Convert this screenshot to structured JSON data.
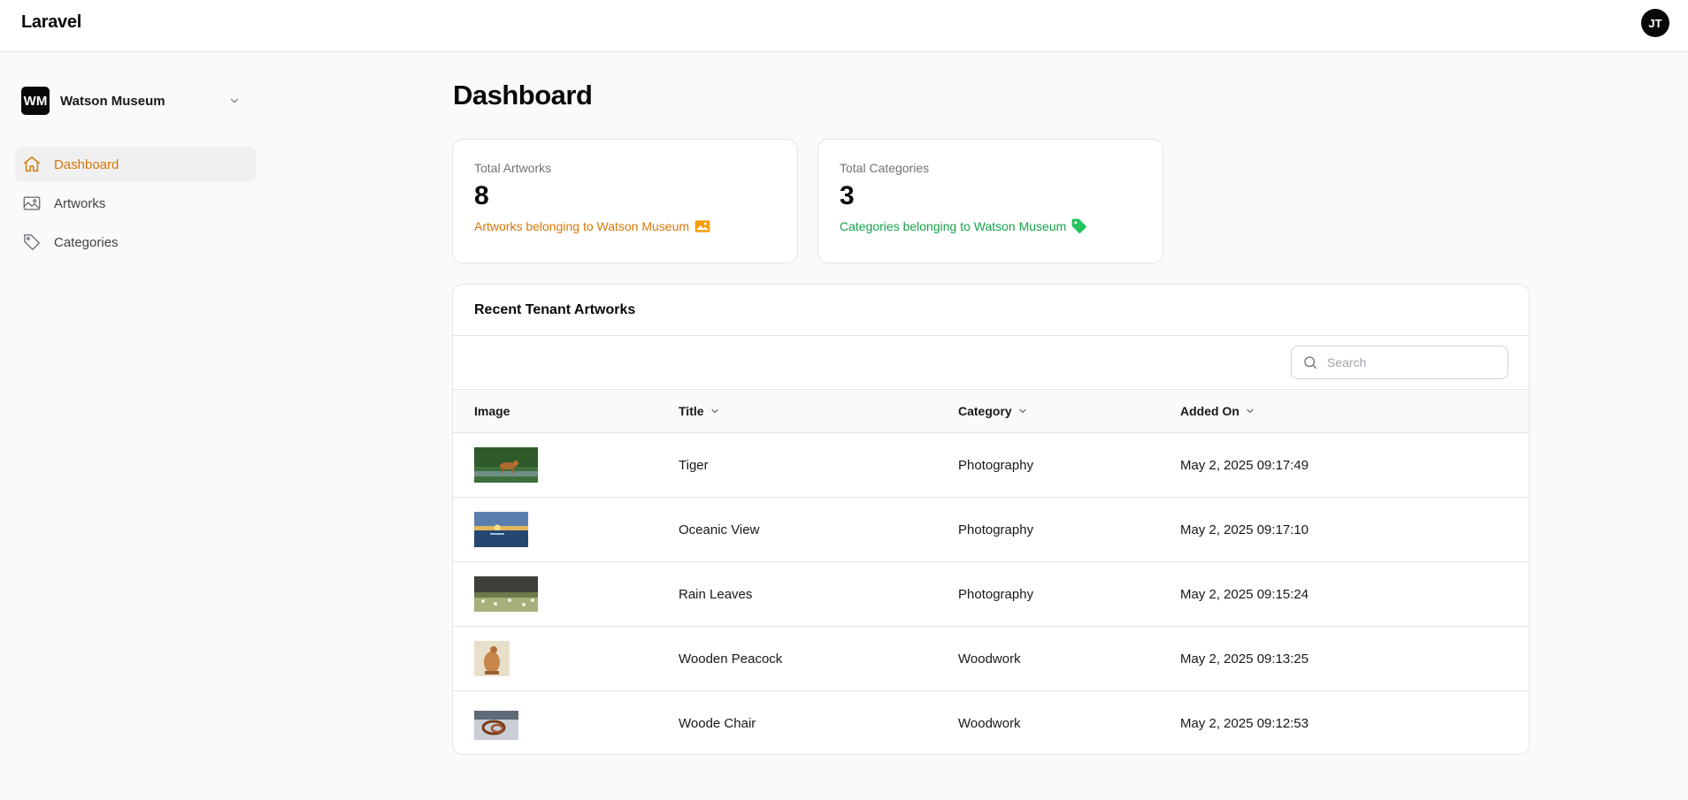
{
  "header": {
    "brand": "Laravel",
    "user_initials": "JT"
  },
  "sidebar": {
    "tenant": {
      "initials": "WM",
      "name": "Watson Museum"
    },
    "items": [
      {
        "label": "Dashboard",
        "icon": "home-icon",
        "active": true
      },
      {
        "label": "Artworks",
        "icon": "image-icon",
        "active": false
      },
      {
        "label": "Categories",
        "icon": "tag-icon",
        "active": false
      }
    ]
  },
  "page": {
    "title": "Dashboard"
  },
  "stats": [
    {
      "label": "Total Artworks",
      "value": "8",
      "description": "Artworks belonging to Watson Museum",
      "icon": "photo-icon",
      "color": "#d97706"
    },
    {
      "label": "Total Categories",
      "value": "3",
      "description": "Categories belonging to Watson Museum",
      "icon": "tag-icon",
      "color": "#16a34a"
    }
  ],
  "table": {
    "heading": "Recent Tenant Artworks",
    "search_placeholder": "Search",
    "columns": {
      "image": "Image",
      "title": "Title",
      "category": "Category",
      "added_on": "Added On"
    },
    "rows": [
      {
        "title": "Tiger",
        "category": "Photography",
        "added_on": "May 2, 2025 09:17:49"
      },
      {
        "title": "Oceanic View",
        "category": "Photography",
        "added_on": "May 2, 2025 09:17:10"
      },
      {
        "title": "Rain Leaves",
        "category": "Photography",
        "added_on": "May 2, 2025 09:15:24"
      },
      {
        "title": "Wooden Peacock",
        "category": "Woodwork",
        "added_on": "May 2, 2025 09:13:25"
      },
      {
        "title": "Woode Chair",
        "category": "Woodwork",
        "added_on": "May 2, 2025 09:12:53"
      }
    ]
  }
}
